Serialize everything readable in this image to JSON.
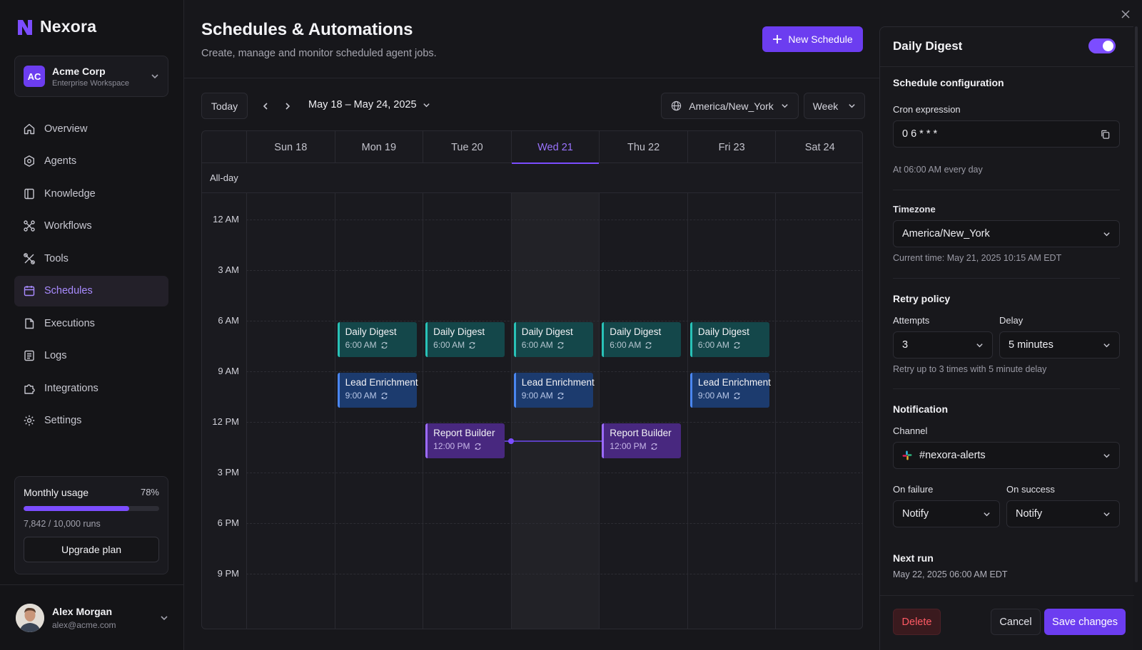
{
  "brand": {
    "name": "Nexora"
  },
  "workspace": {
    "initials": "AC",
    "name": "Acme Corp",
    "subtitle": "Enterprise Workspace"
  },
  "nav": {
    "items": [
      {
        "label": "Overview",
        "icon": "home-icon"
      },
      {
        "label": "Agents",
        "icon": "agent-icon"
      },
      {
        "label": "Knowledge",
        "icon": "book-icon"
      },
      {
        "label": "Workflows",
        "icon": "workflow-icon"
      },
      {
        "label": "Tools",
        "icon": "tools-icon"
      },
      {
        "label": "Schedules",
        "icon": "calendar-icon",
        "active": true
      },
      {
        "label": "Executions",
        "icon": "document-icon"
      },
      {
        "label": "Logs",
        "icon": "logs-icon"
      },
      {
        "label": "Integrations",
        "icon": "puzzle-icon"
      },
      {
        "label": "Settings",
        "icon": "gear-icon"
      }
    ]
  },
  "usage": {
    "title": "Monthly usage",
    "percent_label": "78%",
    "percent": 0.78,
    "runs": "7,842 / 10,000 runs",
    "upgrade_label": "Upgrade plan"
  },
  "user": {
    "name": "Alex Morgan",
    "email": "alex@acme.com"
  },
  "header": {
    "title": "Schedules & Automations",
    "subtitle": "Create, manage and monitor scheduled agent jobs.",
    "new_button": "New Schedule"
  },
  "toolbar": {
    "today": "Today",
    "range": "May 18 – May 24, 2025",
    "timezone": "America/New_York",
    "view": "Week"
  },
  "calendar": {
    "days": [
      "Sun 18",
      "Mon 19",
      "Tue 20",
      "Wed 21",
      "Thu 22",
      "Fri 23",
      "Sat 24"
    ],
    "today_index": 3,
    "allday_label": "All-day",
    "time_labels": [
      "12 AM",
      "3 AM",
      "6 AM",
      "9 AM",
      "12 PM",
      "3 PM",
      "6 PM",
      "9 PM"
    ],
    "events": [
      {
        "title": "Daily Digest",
        "time": "6:00 AM",
        "day": 1,
        "hour": 6,
        "color": "teal"
      },
      {
        "title": "Daily Digest",
        "time": "6:00 AM",
        "day": 2,
        "hour": 6,
        "color": "teal"
      },
      {
        "title": "Daily Digest",
        "time": "6:00 AM",
        "day": 3,
        "hour": 6,
        "color": "teal"
      },
      {
        "title": "Daily Digest",
        "time": "6:00 AM",
        "day": 4,
        "hour": 6,
        "color": "teal"
      },
      {
        "title": "Daily Digest",
        "time": "6:00 AM",
        "day": 5,
        "hour": 6,
        "color": "teal"
      },
      {
        "title": "Lead Enrichment",
        "time": "9:00 AM",
        "day": 1,
        "hour": 9,
        "color": "blue"
      },
      {
        "title": "Lead Enrichment",
        "time": "9:00 AM",
        "day": 3,
        "hour": 9,
        "color": "blue"
      },
      {
        "title": "Lead Enrichment",
        "time": "9:00 AM",
        "day": 5,
        "hour": 9,
        "color": "blue"
      },
      {
        "title": "Report Builder",
        "time": "12:00 PM",
        "day": 2,
        "hour": 12,
        "color": "purple"
      },
      {
        "title": "Report Builder",
        "time": "12:00 PM",
        "day": 4,
        "hour": 12,
        "color": "purple"
      }
    ]
  },
  "panel": {
    "title": "Daily Digest",
    "enabled": true,
    "schedule_config_title": "Schedule configuration",
    "cron_label": "Cron expression",
    "cron_value": "0 6 * * *",
    "cron_hint": "At 06:00 AM every day",
    "timezone_label": "Timezone",
    "timezone_value": "America/New_York",
    "timezone_hint": "Current time: May 21, 2025 10:15 AM EDT",
    "retry_title": "Retry policy",
    "attempts_label": "Attempts",
    "attempts_value": "3",
    "delay_label": "Delay",
    "delay_value": "5 minutes",
    "retry_hint": "Retry up to 3 times with 5 minute delay",
    "notification_title": "Notification",
    "channel_label": "Channel",
    "channel_value": "#nexora-alerts",
    "failure_label": "On failure",
    "failure_value": "Notify",
    "success_label": "On success",
    "success_value": "Notify",
    "next_run_title": "Next run",
    "next_run_value": "May 22, 2025 06:00 AM EDT",
    "delete_label": "Delete",
    "cancel_label": "Cancel",
    "save_label": "Save changes"
  },
  "colors": {
    "accent": "#7c4dff",
    "teal": "#29c2b7",
    "blue": "#4a86f0",
    "purple": "#9c6bff",
    "danger": "#ff5a64"
  }
}
